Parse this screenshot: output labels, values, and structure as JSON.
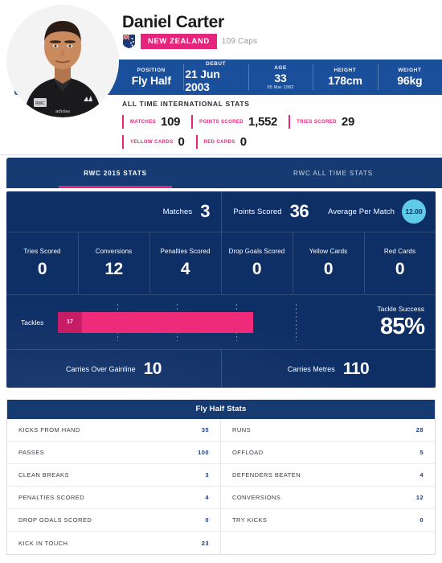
{
  "player": {
    "name": "Daniel Carter",
    "nation": "NEW ZEALAND",
    "caps": "109 Caps",
    "flag_icon": "new-zealand-flag-icon",
    "photo_alt": "player-portrait"
  },
  "bio": [
    {
      "label": "POSITION",
      "value": "Fly Half",
      "sub": ""
    },
    {
      "label": "DEBUT",
      "value": "21 Jun 2003",
      "sub": ""
    },
    {
      "label": "AGE",
      "value": "33",
      "sub": "05 Mar 1982"
    },
    {
      "label": "HEIGHT",
      "value": "178cm",
      "sub": ""
    },
    {
      "label": "WEIGHT",
      "value": "96kg",
      "sub": ""
    }
  ],
  "all_time": {
    "title": "ALL TIME INTERNATIONAL STATS",
    "items": [
      {
        "label": "MATCHES",
        "value": "109"
      },
      {
        "label": "POINTS SCORED",
        "value": "1,552"
      },
      {
        "label": "TRIES SCORED",
        "value": "29"
      },
      {
        "label": "YELLOW CARDS",
        "value": "0"
      },
      {
        "label": "RED CARDS",
        "value": "0"
      }
    ]
  },
  "tabs": [
    {
      "label": "RWC 2015 STATS",
      "active": true
    },
    {
      "label": "RWC ALL TIME STATS",
      "active": false
    }
  ],
  "summary": {
    "matches_label": "Matches",
    "matches_value": "3",
    "points_label": "Points Scored",
    "points_value": "36",
    "average_label": "Average Per Match",
    "average_value": "12.00"
  },
  "tiles": [
    {
      "label": "Tries Scored",
      "value": "0"
    },
    {
      "label": "Conversions",
      "value": "12"
    },
    {
      "label": "Penalties Scored",
      "value": "4"
    },
    {
      "label": "Drop Goals Scored",
      "value": "0"
    },
    {
      "label": "Yellow Cards",
      "value": "0"
    },
    {
      "label": "Red Cards",
      "value": "0"
    }
  ],
  "tackles": {
    "label": "Tackles",
    "value": "17",
    "bar_percent": 82,
    "success_label": "Tackle Success",
    "success_value": "85%"
  },
  "carries": [
    {
      "label": "Carries Over Gainline",
      "value": "10"
    },
    {
      "label": "Carries Metres",
      "value": "110"
    }
  ],
  "position_stats": {
    "title": "Fly Half Stats",
    "left": [
      {
        "key": "KICKS FROM HAND",
        "value": "35"
      },
      {
        "key": "PASSES",
        "value": "100"
      },
      {
        "key": "CLEAN BREAKS",
        "value": "3"
      },
      {
        "key": "PENALTIES SCORED",
        "value": "4"
      },
      {
        "key": "DROP GOALS SCORED",
        "value": "0"
      },
      {
        "key": "KICK IN TOUCH",
        "value": "23"
      }
    ],
    "right": [
      {
        "key": "RUNS",
        "value": "28"
      },
      {
        "key": "OFFLOAD",
        "value": "5"
      },
      {
        "key": "DEFENDERS BEATEN",
        "value": "4"
      },
      {
        "key": "CONVERSIONS",
        "value": "12"
      },
      {
        "key": "TRY KICKS",
        "value": "0"
      }
    ]
  },
  "colors": {
    "brand_blue": "#163b72",
    "panel_blue": "#0e2f66",
    "bio_blue": "#1a4f9c",
    "accent_pink": "#e5247b",
    "bar_pink": "#ee2a7b",
    "cyan": "#5ecbe8"
  }
}
